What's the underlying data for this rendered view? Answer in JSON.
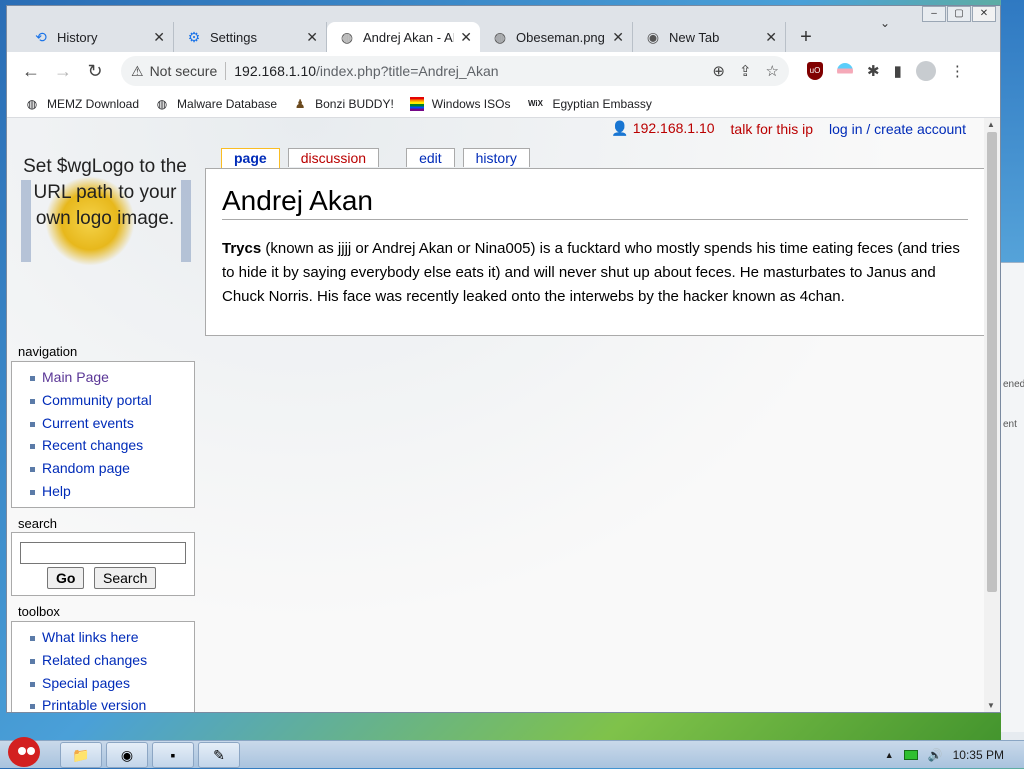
{
  "browser": {
    "tabs": [
      {
        "label": "History",
        "icon": "history-icon",
        "active": false
      },
      {
        "label": "Settings",
        "icon": "gear-icon",
        "active": false
      },
      {
        "label": "Andrej Akan - AI",
        "icon": "globe-icon",
        "active": true
      },
      {
        "label": "Obeseman.png",
        "icon": "globe-icon",
        "active": false
      },
      {
        "label": "New Tab",
        "icon": "chrome-icon",
        "active": false
      }
    ],
    "omnibox": {
      "security_label": "Not secure",
      "host": "192.168.1.10",
      "path": "/index.php?title=Andrej_Akan"
    },
    "bookmarks": [
      {
        "label": "MEMZ Download",
        "icon": "globe-icon"
      },
      {
        "label": "Malware Database",
        "icon": "globe-icon"
      },
      {
        "label": "Bonzi BUDDY!",
        "icon": "bonzi-icon"
      },
      {
        "label": "Windows ISOs",
        "icon": "rainbow-flag-icon"
      },
      {
        "label": "Egyptian Embassy",
        "icon": "wix-icon"
      }
    ]
  },
  "wiki": {
    "personal": {
      "ip": "192.168.1.10",
      "talk": "talk for this ip",
      "login": "log in / create account"
    },
    "logo_text": "Set $wgLogo to the URL path to your own logo image.",
    "tabs": {
      "page": "page",
      "discussion": "discussion",
      "edit": "edit",
      "history": "history"
    },
    "article": {
      "title": "Andrej Akan",
      "bold_term": "Trycs",
      "body": "(known as jjjj or Andrej Akan or Nina005) is a fucktard who mostly spends his time eating feces (and tries to hide it by saying everybody else eats it) and will never shut up about feces. He masturbates to Janus and Chuck Norris. His face was recently leaked onto the interwebs by the hacker known as 4chan."
    },
    "navigation": {
      "title": "navigation",
      "items": [
        "Main Page",
        "Community portal",
        "Current events",
        "Recent changes",
        "Random page",
        "Help"
      ]
    },
    "search": {
      "title": "search",
      "go_label": "Go",
      "search_label": "Search"
    },
    "toolbox": {
      "title": "toolbox",
      "items": [
        "What links here",
        "Related changes",
        "Special pages",
        "Printable version"
      ]
    }
  },
  "desktop": {
    "fragments": [
      "ened",
      "ent"
    ]
  },
  "taskbar": {
    "clock": "10:35 PM"
  }
}
